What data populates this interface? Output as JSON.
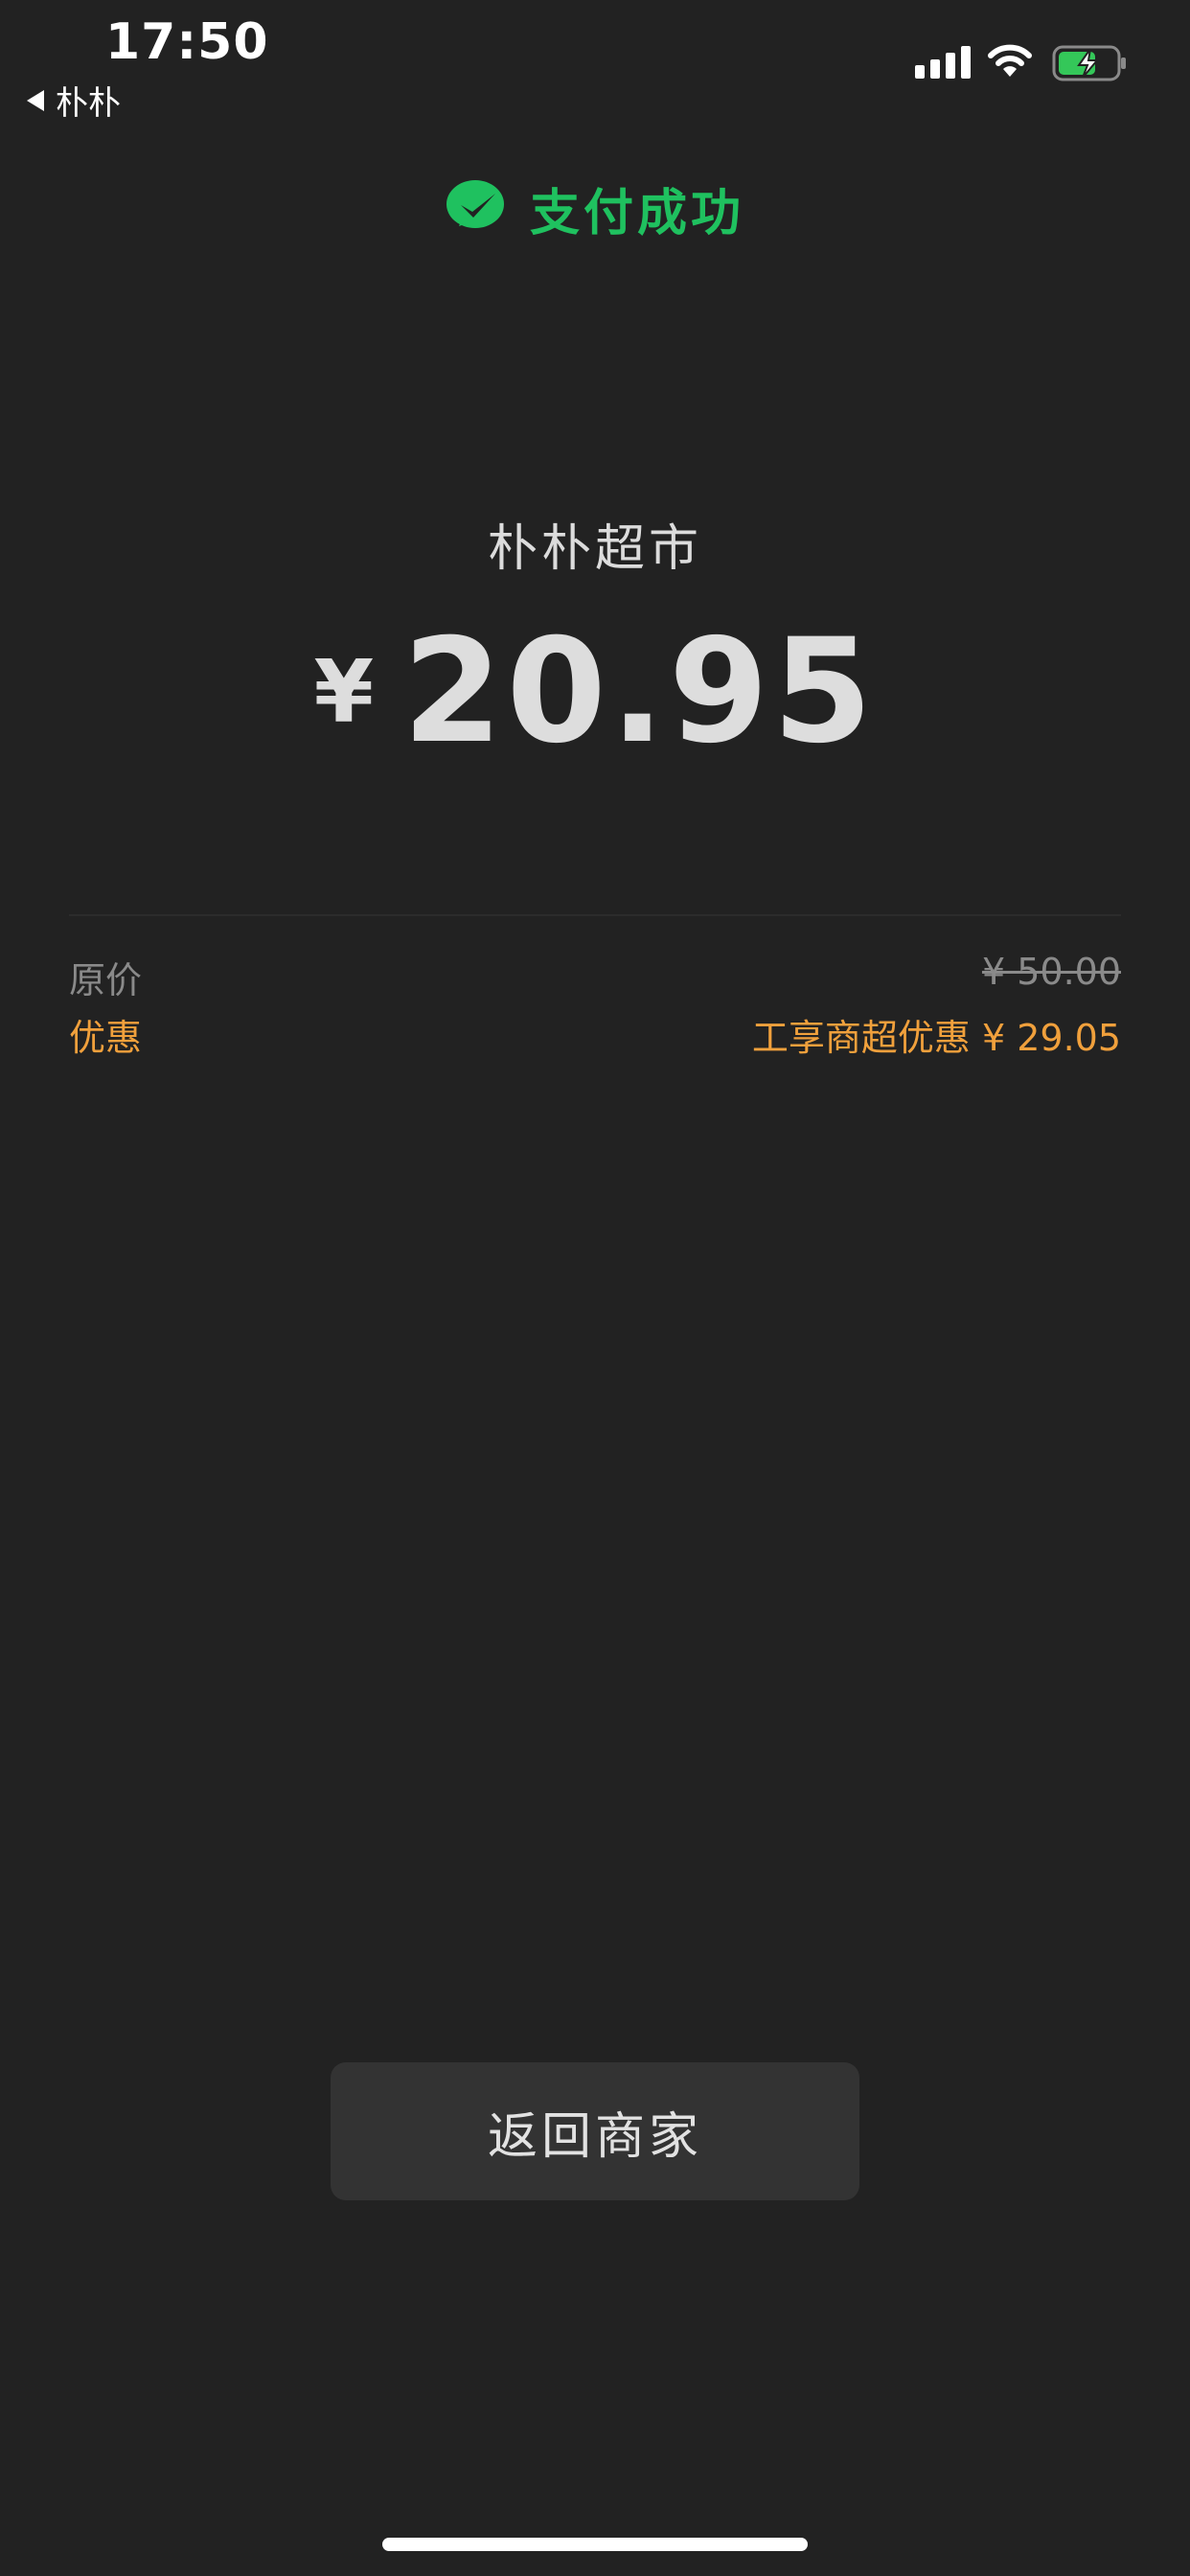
{
  "status_bar": {
    "time": "17:50",
    "back_label": "朴朴"
  },
  "header": {
    "title": "支付成功",
    "icon": "wechat-pay-icon",
    "accent_color": "#1fc15f"
  },
  "payment": {
    "merchant": "朴朴超市",
    "currency": "¥",
    "amount": "20.95"
  },
  "details": {
    "original_label": "原价",
    "original_value": "¥ 50.00",
    "discount_label": "优惠",
    "discount_value": "工享商超优惠 ¥ 29.05",
    "discount_color": "#f0a03c"
  },
  "actions": {
    "return_label": "返回商家"
  }
}
